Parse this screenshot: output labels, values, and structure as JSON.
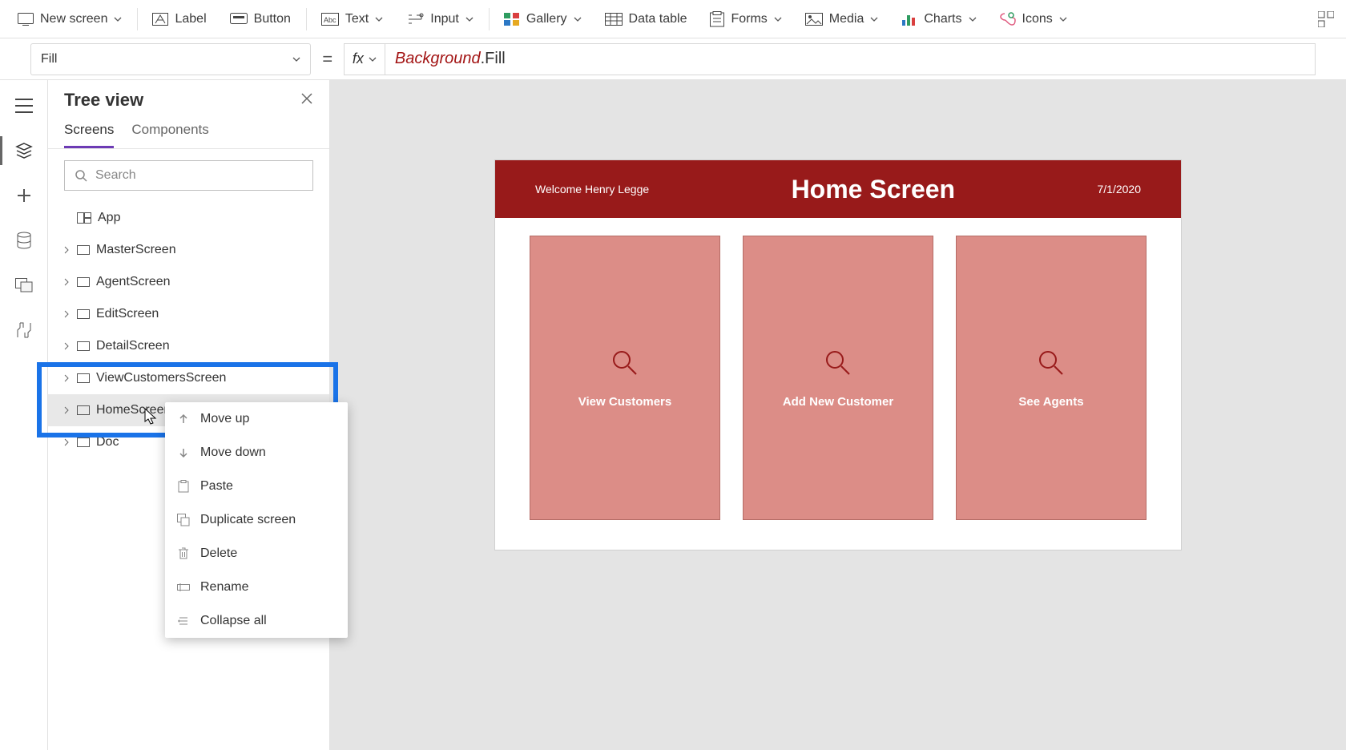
{
  "toolbar": {
    "newScreen": "New screen",
    "label": "Label",
    "button": "Button",
    "text": "Text",
    "input": "Input",
    "gallery": "Gallery",
    "dataTable": "Data table",
    "forms": "Forms",
    "media": "Media",
    "charts": "Charts",
    "icons": "Icons"
  },
  "formula": {
    "property": "Fill",
    "token1": "Background",
    "token2": ".Fill"
  },
  "treeView": {
    "title": "Tree view",
    "tabScreens": "Screens",
    "tabComponents": "Components",
    "searchPlaceholder": "Search",
    "app": "App",
    "items": [
      "MasterScreen",
      "AgentScreen",
      "EditScreen",
      "DetailScreen",
      "ViewCustomersScreen",
      "HomeScreen",
      "Doc"
    ]
  },
  "contextMenu": {
    "moveUp": "Move up",
    "moveDown": "Move down",
    "paste": "Paste",
    "duplicate": "Duplicate screen",
    "delete": "Delete",
    "rename": "Rename",
    "collapseAll": "Collapse all"
  },
  "preview": {
    "welcome": "Welcome Henry Legge",
    "title": "Home Screen",
    "date": "7/1/2020",
    "cards": [
      "View Customers",
      "Add New Customer",
      "See Agents"
    ]
  }
}
